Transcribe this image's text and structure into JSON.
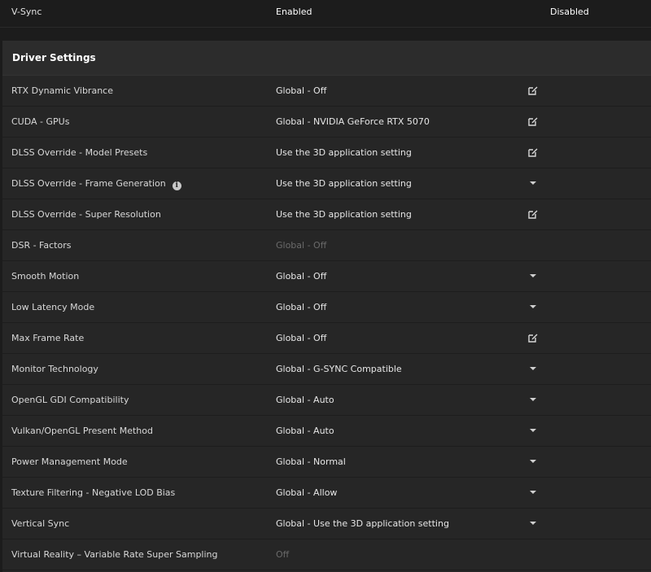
{
  "top_row": {
    "label": "V-Sync",
    "value_1": "Enabled",
    "value_2": "Disabled"
  },
  "section": {
    "title": "Driver Settings"
  },
  "rows": [
    {
      "name": "RTX Dynamic Vibrance",
      "value": "Global - Off",
      "action": "edit-icon"
    },
    {
      "name": "CUDA - GPUs",
      "value": "Global - NVIDIA GeForce RTX 5070",
      "action": "edit-icon"
    },
    {
      "name": "DLSS Override - Model Presets",
      "value": "Use the 3D application setting",
      "action": "edit-icon"
    },
    {
      "name": "DLSS Override - Frame Generation",
      "value": "Use the 3D application setting",
      "action": "chevron-down-icon"
    },
    {
      "name": "DLSS Override - Super Resolution",
      "value": "Use the 3D application setting",
      "action": "edit-icon"
    },
    {
      "name": "DSR - Factors",
      "value": "Global - Off",
      "action": "none"
    },
    {
      "name": "Smooth Motion",
      "value": "Global - Off",
      "action": "chevron-down-icon"
    },
    {
      "name": "Low Latency Mode",
      "value": "Global - Off",
      "action": "chevron-down-icon"
    },
    {
      "name": "Max Frame Rate",
      "value": "Global - Off",
      "action": "edit-icon"
    },
    {
      "name": "Monitor Technology",
      "value": "Global - G-SYNC Compatible",
      "action": "chevron-down-icon"
    },
    {
      "name": "OpenGL GDI Compatibility",
      "value": "Global - Auto",
      "action": "chevron-down-icon"
    },
    {
      "name": "Vulkan/OpenGL Present Method",
      "value": "Global - Auto",
      "action": "chevron-down-icon"
    },
    {
      "name": "Power Management Mode",
      "value": "Global - Normal",
      "action": "chevron-down-icon"
    },
    {
      "name": "Texture Filtering - Negative LOD Bias",
      "value": "Global - Allow",
      "action": "chevron-down-icon"
    },
    {
      "name": "Vertical Sync",
      "value": "Global - Use the 3D application setting",
      "action": "chevron-down-icon"
    },
    {
      "name": "Virtual Reality – Variable Rate Super Sampling",
      "value": "Off",
      "action": "none"
    }
  ],
  "info_icon_glyph": "i",
  "colors": {
    "background": "#1c1c1c",
    "panel": "#262626",
    "header": "#2c2c2c",
    "disabled_text": "#6a6a6a"
  }
}
